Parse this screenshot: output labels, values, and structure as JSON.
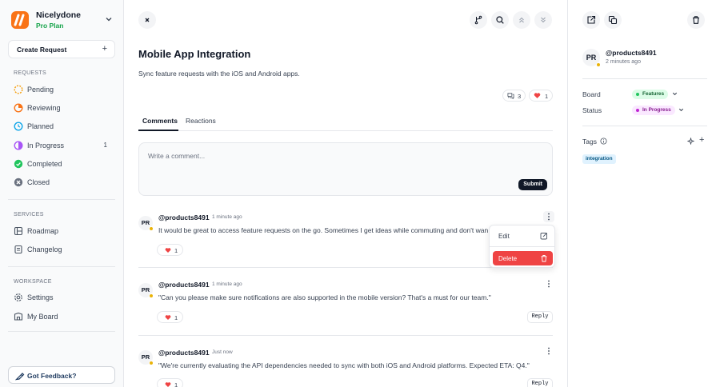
{
  "sidebar": {
    "brand": {
      "name": "Nicelydone",
      "plan": "Pro Plan"
    },
    "create_button": "Create Request",
    "sections": {
      "requests": "REQUESTS",
      "services": "SERVICES",
      "workspace": "WORKSPACE"
    },
    "requests_items": [
      {
        "label": "Pending",
        "icon": "pending-status-icon",
        "count": ""
      },
      {
        "label": "Reviewing",
        "icon": "reviewing-status-icon",
        "count": ""
      },
      {
        "label": "Planned",
        "icon": "planned-status-icon",
        "count": ""
      },
      {
        "label": "In Progress",
        "icon": "in-progress-status-icon",
        "count": "1"
      },
      {
        "label": "Completed",
        "icon": "completed-status-icon",
        "count": ""
      },
      {
        "label": "Closed",
        "icon": "closed-status-icon",
        "count": ""
      }
    ],
    "services_items": [
      {
        "label": "Roadmap",
        "icon": "roadmap-icon"
      },
      {
        "label": "Changelog",
        "icon": "changelog-icon"
      }
    ],
    "workspace_items": [
      {
        "label": "Settings",
        "icon": "gear-icon"
      },
      {
        "label": "My Board",
        "icon": "board-icon"
      }
    ],
    "feedback_button": "Got Feedback?"
  },
  "request": {
    "title": "Mobile App Integration",
    "description": "Sync feature requests with the iOS and Android apps.",
    "comment_count": "3",
    "reaction_count": "1"
  },
  "tabs": [
    {
      "label": "Comments",
      "active": true
    },
    {
      "label": "Reactions",
      "active": false
    }
  ],
  "composer": {
    "placeholder": "Write a comment...",
    "submit_label": "Submit"
  },
  "comments": [
    {
      "initials": "PR",
      "user": "@products8491",
      "time": "1 minute ago",
      "text": "It would be great to access feature requests on the go. Sometimes I get ideas while commuting and don't wan",
      "reactions": "1",
      "reply_label": ""
    },
    {
      "initials": "PR",
      "user": "@products8491",
      "time": "1 minute ago",
      "text": "\"Can you please make sure notifications are also supported in the mobile version? That's a must for our team.\"",
      "reactions": "1",
      "reply_label": "Reply"
    },
    {
      "initials": "PR",
      "user": "@products8491",
      "time": "Just now",
      "text": "\"We're currently evaluating the API dependencies needed to sync with both iOS and Android platforms. Expected ETA: Q4.\"",
      "reactions": "1",
      "reply_label": "Reply"
    }
  ],
  "context_menu": {
    "edit_label": "Edit",
    "delete_label": "Delete"
  },
  "details": {
    "author_initials": "PR",
    "author": "@products8491",
    "posted": "2 minutes ago",
    "board_label": "Board",
    "board_value": "Features",
    "status_label": "Status",
    "status_value": "In Progress",
    "tags_label": "Tags",
    "tags": [
      "integration"
    ]
  },
  "colors": {
    "brand": "#f97316",
    "plan": "#16a34a",
    "delete": "#ef4444",
    "features_badge_bg": "#dcfce7",
    "in_progress_badge_bg": "#fae8ff",
    "tag_bg": "#e0f2fe",
    "heart": "#ef4444"
  }
}
